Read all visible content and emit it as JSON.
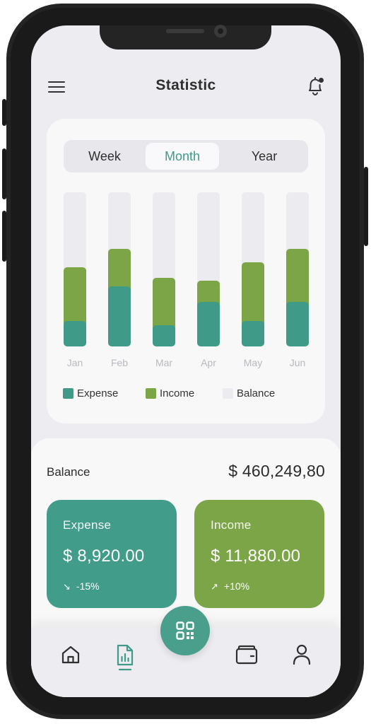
{
  "header": {
    "title": "Statistic"
  },
  "tabs": [
    {
      "label": "Week",
      "active": false
    },
    {
      "label": "Month",
      "active": true
    },
    {
      "label": "Year",
      "active": false
    }
  ],
  "chart_data": {
    "type": "bar",
    "stacked": true,
    "categories": [
      "Jan",
      "Feb",
      "Mar",
      "Apr",
      "May",
      "Jun"
    ],
    "series": [
      {
        "name": "Expense",
        "color": "#3f9b88",
        "values": [
          19,
          45,
          16,
          33,
          19,
          33
        ]
      },
      {
        "name": "Income",
        "color": "#7ba546",
        "values": [
          40,
          28,
          35,
          16,
          44,
          40
        ]
      },
      {
        "name": "Balance",
        "color": "#ececf0",
        "values": [
          56,
          42,
          64,
          66,
          52,
          42
        ]
      }
    ],
    "ylim": [
      0,
      115
    ]
  },
  "legend": [
    {
      "label": "Expense",
      "color": "#3f9b88"
    },
    {
      "label": "Income",
      "color": "#7ba546"
    },
    {
      "label": "Balance",
      "color": "#ececf0"
    }
  ],
  "balance": {
    "label": "Balance",
    "value": "$ 460,249,80"
  },
  "cards": {
    "expense": {
      "label": "Expense",
      "amount": "$ 8,920.00",
      "change": "-15%",
      "color": "#429c8a",
      "icon": "arrow-down-right-icon"
    },
    "income": {
      "label": "Income",
      "amount": "$ 11,880.00",
      "change": "+10%",
      "color": "#7ba546",
      "icon": "arrow-up-right-icon"
    }
  },
  "nav": [
    {
      "name": "home",
      "icon": "home-icon",
      "active": false
    },
    {
      "name": "statistics",
      "icon": "stats-document-icon",
      "active": true
    },
    {
      "name": "scan",
      "icon": "qr-code-icon",
      "active": false
    },
    {
      "name": "wallet",
      "icon": "wallet-icon",
      "active": false
    },
    {
      "name": "profile",
      "icon": "user-icon",
      "active": false
    }
  ],
  "colors": {
    "accent": "#3f9b88",
    "income": "#7ba546",
    "background": "#ededf1"
  }
}
